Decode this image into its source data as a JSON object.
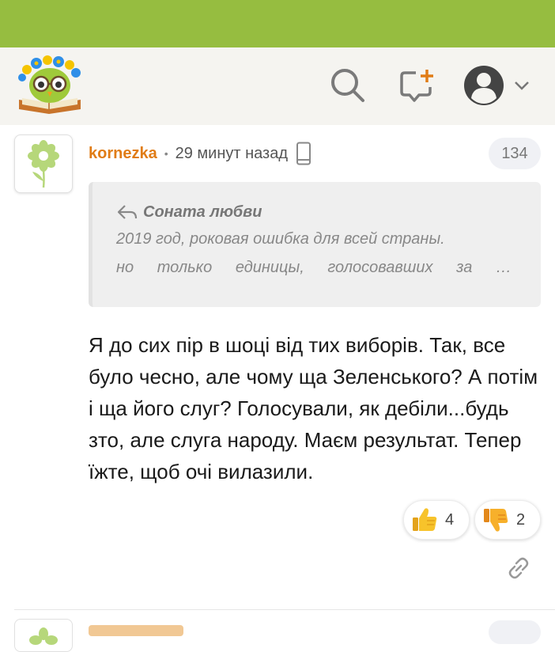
{
  "colors": {
    "accent_green": "#96bd40",
    "author_orange": "#e07c16",
    "header_bg": "#f5f4f0",
    "quote_bg": "#efefef"
  },
  "header": {
    "logo_icon": "owl-book-logo",
    "icons": [
      "search-icon",
      "new-post-icon",
      "profile-avatar-icon",
      "chevron-down-icon"
    ]
  },
  "comment": {
    "author": "kornezka",
    "separator": "•",
    "time": "29 минут назад",
    "device_icon": "mobile-phone-icon",
    "number": "134",
    "quote": {
      "icon": "reply-arrow-icon",
      "author": "Соната любви",
      "line1": "2019 год, роковая ошибка для всей страны.",
      "line2_words": [
        "но",
        "только",
        "единицы,",
        "голосовавших",
        "за",
        "…"
      ]
    },
    "text": "Я до сих пір в шоці від тих виборів. Так, все було чесно, але чому ща Зеленського? А потім і ща його слуг? Голосували, як дебіли...будь зто, але слуга народу. Маєм результат. Тепер їжте, щоб очі вилазили.",
    "likes": "4",
    "dislikes": "2",
    "link_icon": "link-icon"
  }
}
